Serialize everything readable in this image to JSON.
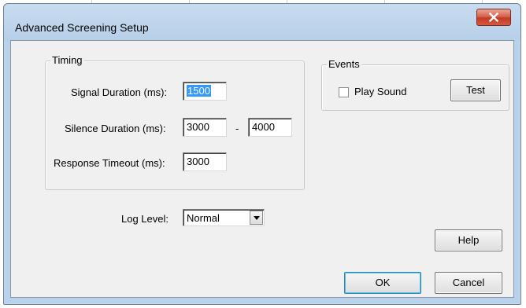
{
  "window": {
    "title": "Advanced Screening Setup"
  },
  "icons": {
    "close": "close-icon",
    "dropdown": "chevron-down-icon"
  },
  "timing": {
    "legend": "Timing",
    "signal_label": "Signal Duration (ms):",
    "signal_value": "1500",
    "silence_label": "Silence Duration (ms):",
    "silence_min": "3000",
    "range_separator": "-",
    "silence_max": "4000",
    "timeout_label": "Response Timeout (ms):",
    "timeout_value": "3000"
  },
  "events": {
    "legend": "Events",
    "play_sound_label": "Play Sound",
    "play_sound_checked": false,
    "test_button": "Test"
  },
  "log": {
    "label": "Log Level:",
    "selected": "Normal"
  },
  "buttons": {
    "help": "Help",
    "ok": "OK",
    "cancel": "Cancel"
  },
  "colors": {
    "selection": "#3399ff",
    "close_button": "#c43a23",
    "frame": "#b9d1ea",
    "client": "#f0f0f0"
  }
}
